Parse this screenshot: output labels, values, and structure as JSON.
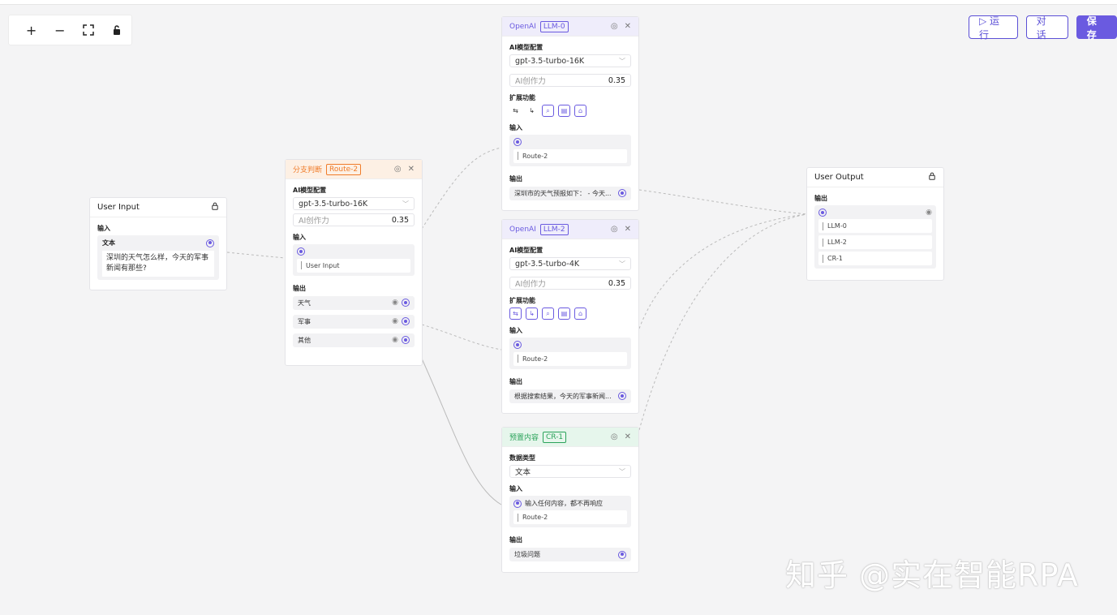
{
  "toolbar": {
    "zoom_in": "+",
    "zoom_out": "−",
    "fit": "⛶",
    "lock": "🔒"
  },
  "actions": {
    "run": "▷ 运行",
    "chat": "对 话",
    "save": "保 存"
  },
  "colors": {
    "accent": "#6a5ae0",
    "route": "#f07c2a",
    "llm": "#6a5ae0",
    "cr": "#2aa35a"
  },
  "user_input": {
    "title": "User Input",
    "input_label": "输入",
    "field_label": "文本",
    "text": "深圳的天气怎么样，今天的军事新闻有那些?"
  },
  "route": {
    "name": "分支判断",
    "tag": "Route-2",
    "model_label": "AI模型配置",
    "model": "gpt-3.5-turbo-16K",
    "creativity_label": "AI创作力",
    "creativity": "0.35",
    "input_label": "输入",
    "input_ref": "User Input",
    "output_label": "输出",
    "outputs": [
      "天气",
      "军事",
      "其他"
    ]
  },
  "llm0": {
    "name": "OpenAI",
    "tag": "LLM-0",
    "model_label": "AI模型配置",
    "model": "gpt-3.5-turbo-16K",
    "creativity_label": "AI创作力",
    "creativity": "0.35",
    "ext_label": "扩展功能",
    "input_label": "输入",
    "input_ref": "Route-2",
    "output_label": "输出",
    "output": "深圳市的天气预报如下： - 今天..."
  },
  "llm2": {
    "name": "OpenAI",
    "tag": "LLM-2",
    "model_label": "AI模型配置",
    "model": "gpt-3.5-turbo-4K",
    "creativity_label": "AI创作力",
    "creativity": "0.35",
    "ext_label": "扩展功能",
    "input_label": "输入",
    "input_ref": "Route-2",
    "output_label": "输出",
    "output": "根据搜索结果，今天的军事新闻..."
  },
  "cr": {
    "name": "预置内容",
    "tag": "CR-1",
    "type_label": "数据类型",
    "type": "文本",
    "input_label": "输入",
    "input_hint": "输入任何内容，都不再响应",
    "input_ref": "Route-2",
    "output_label": "输出",
    "output": "垃圾问题"
  },
  "user_output": {
    "title": "User Output",
    "output_label": "输出",
    "refs": [
      "LLM-0",
      "LLM-2",
      "CR-1"
    ]
  },
  "watermark": "知乎 @实在智能RPA"
}
